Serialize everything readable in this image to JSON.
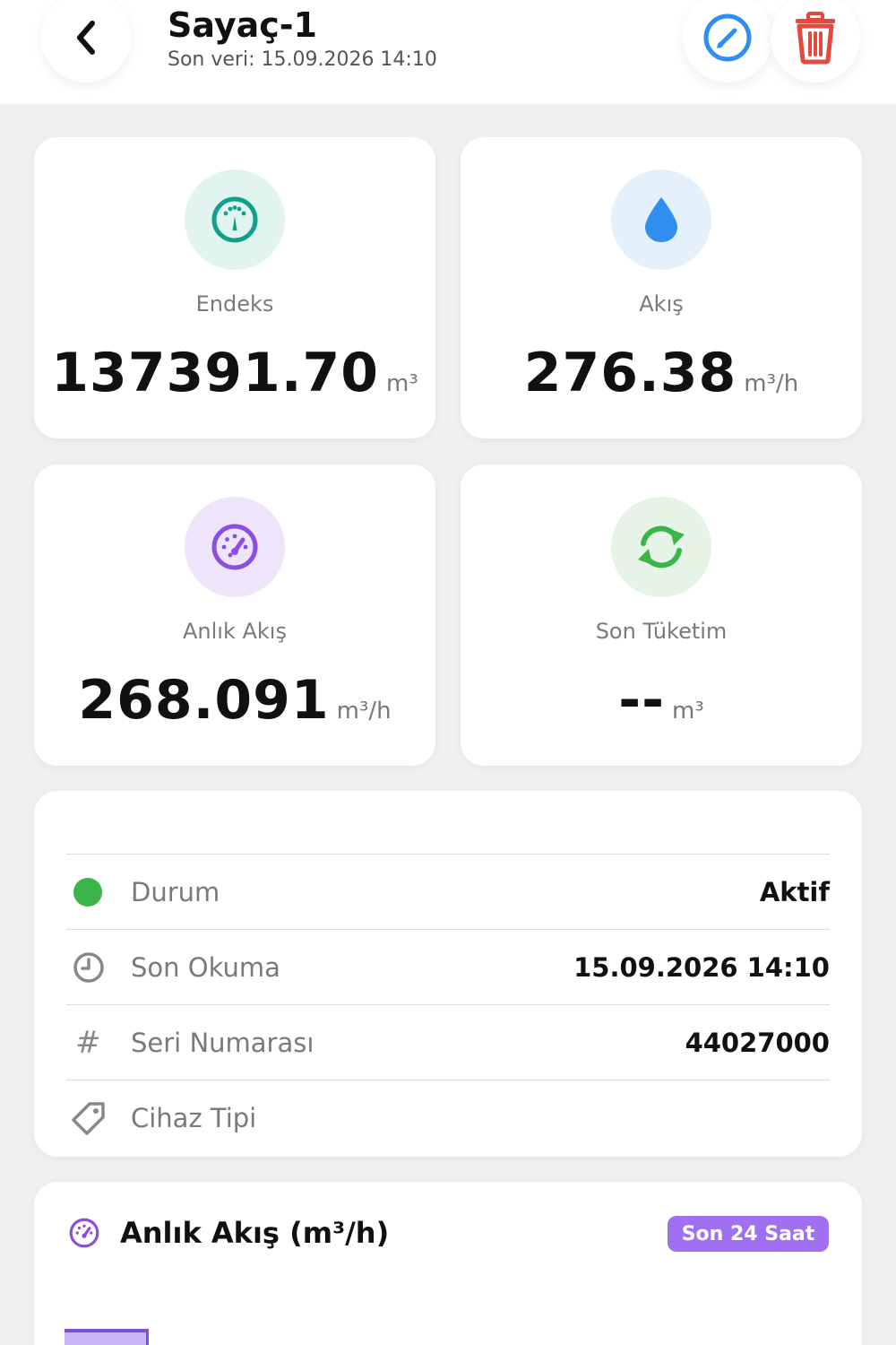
{
  "header": {
    "title": "Sayaç-1",
    "subtitle": "Son veri: 15.09.2026 14:10"
  },
  "colors": {
    "accent_blue": "#2f8ef0",
    "danger_red": "#e8473e",
    "teal": "#13a08a",
    "purple": "#8a4fe0",
    "green": "#3bb54a"
  },
  "icons": {
    "back": "chevron-left-icon",
    "edit": "pencil-circle-icon",
    "delete": "trash-icon",
    "endeks": "gauge-icon",
    "akis": "water-drop-icon",
    "anlik": "speedometer-icon",
    "tuketim": "refresh-icon"
  },
  "stats": {
    "endeks": {
      "label": "Endeks",
      "value": "137391.70",
      "unit": "m³"
    },
    "akis": {
      "label": "Akış",
      "value": "276.38",
      "unit": "m³/h"
    },
    "anlik": {
      "label": "Anlık Akış",
      "value": "268.091",
      "unit": "m³/h"
    },
    "tuketim": {
      "label": "Son Tüketim",
      "value": "--",
      "unit": "m³"
    }
  },
  "info": {
    "durum": {
      "label": "Durum",
      "value": "Aktif"
    },
    "son_okuma": {
      "label": "Son Okuma",
      "value": "15.09.2026 14:10"
    },
    "seri": {
      "label": "Seri Numarası",
      "value": "44027000"
    },
    "cihaz": {
      "label": "Cihaz Tipi",
      "value": ""
    }
  },
  "chart": {
    "title": "Anlık Akış (m³/h)",
    "range_badge": "Son 24 Saat"
  }
}
